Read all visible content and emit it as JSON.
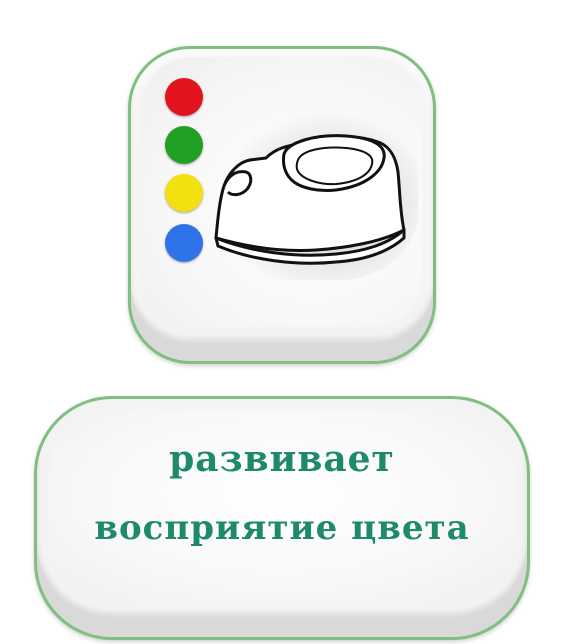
{
  "caption": {
    "line1": "развивает",
    "line2": "восприятие цвета"
  },
  "dots": [
    {
      "name": "red-dot",
      "color": "#e3141f"
    },
    {
      "name": "green-dot",
      "color": "#22a024"
    },
    {
      "name": "yellow-dot",
      "color": "#f2e10e"
    },
    {
      "name": "blue-dot",
      "color": "#2e73e8"
    }
  ],
  "colors": {
    "accent_text": "#1f8a6b",
    "border_green": "#7fbf7f"
  },
  "icons": {
    "main_icon": "potty-icon"
  }
}
